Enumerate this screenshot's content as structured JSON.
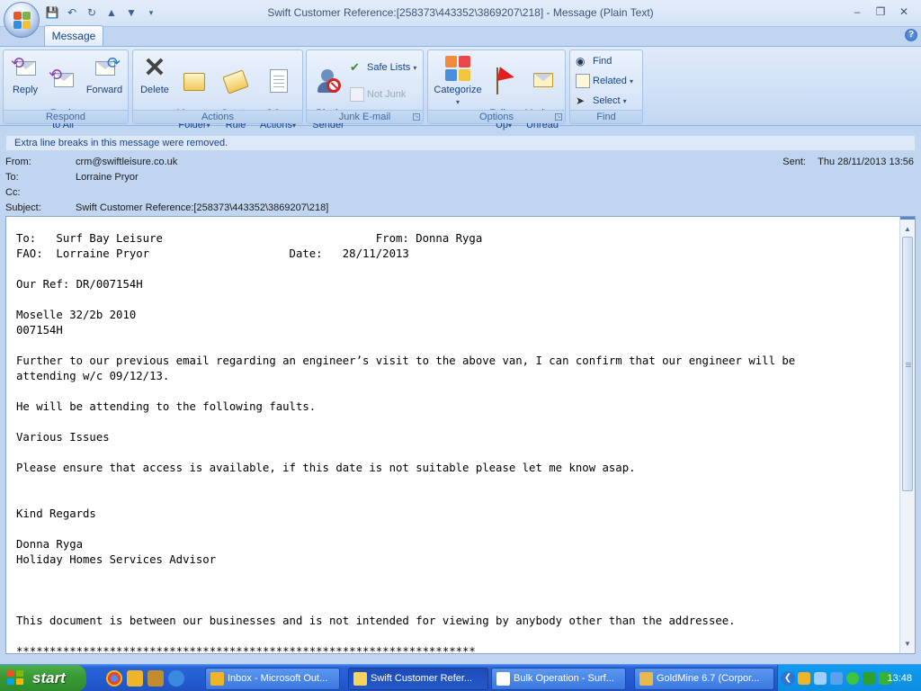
{
  "window": {
    "title": "Swift Customer Reference:[258373\\443352\\3869207\\218] - Message (Plain Text)",
    "minimize": "–",
    "restore": "❐",
    "close": "✕"
  },
  "qat": {
    "save_icon": "save-icon",
    "undo_icon": "undo-icon",
    "redo_icon": "redo-icon",
    "prev_icon": "up-arrow-icon",
    "next_icon": "down-arrow-icon",
    "customize_icon": "chevron-down-icon"
  },
  "tabs": [
    {
      "label": "Message"
    }
  ],
  "help": "?",
  "ribbon": {
    "respond": {
      "label": "Respond",
      "reply": "Reply",
      "reply_all": "Reply\nto All",
      "forward": "Forward"
    },
    "actions": {
      "label": "Actions",
      "delete": "Delete",
      "move_to_folder": "Move to\nFolder",
      "create_rule": "Create\nRule",
      "other_actions": "Other\nActions"
    },
    "junk": {
      "label": "Junk E-mail",
      "block_sender": "Block\nSender",
      "safe_lists": "Safe Lists",
      "not_junk": "Not Junk"
    },
    "options": {
      "label": "Options",
      "categorize": "Categorize",
      "follow_up": "Follow\nUp",
      "mark_as_unread": "Mark as\nUnread"
    },
    "find": {
      "label": "Find",
      "find": "Find",
      "related": "Related",
      "select": "Select"
    }
  },
  "infobar": "Extra line breaks in this message were removed.",
  "header": {
    "from_label": "From:",
    "from": "crm@swiftleisure.co.uk",
    "to_label": "To:",
    "to": "Lorraine Pryor",
    "cc_label": "Cc:",
    "cc": "",
    "subject_label": "Subject:",
    "subject": "Swift Customer Reference:[258373\\443352\\3869207\\218]",
    "sent_label": "Sent:",
    "sent": "Thu 28/11/2013 13:56"
  },
  "body_lines": [
    "To:   Surf Bay Leisure                                From: Donna Ryga",
    "FAO:  Lorraine Pryor                     Date:   28/11/2013",
    "",
    "Our Ref: DR/007154H",
    "",
    "Moselle 32/2b 2010",
    "007154H",
    "",
    "Further to our previous email regarding an engineer’s visit to the above van, I can confirm that our engineer will be",
    "attending w/c 09/12/13.",
    "",
    "He will be attending to the following faults.",
    "",
    "Various Issues",
    "",
    "Please ensure that access is available, if this date is not suitable please let me know asap.",
    "",
    "",
    "Kind Regards",
    "",
    "Donna Ryga",
    "Holiday Homes Services Advisor",
    "",
    "",
    "",
    "This document is between our businesses and is not intended for viewing by anybody other than the addressee.",
    "",
    "*********************************************************************"
  ],
  "taskbar": {
    "start": "start",
    "items": [
      {
        "label": "Inbox - Microsoft Out...",
        "color": "#f0b429"
      },
      {
        "label": "Swift Customer Refer...",
        "color": "#f6d35a"
      },
      {
        "label": "Bulk Operation - Surf...",
        "color": "#ffffff"
      },
      {
        "label": "GoldMine 6.7 (Corpor...",
        "color": "#e8b84a"
      }
    ],
    "clock": "13:48"
  }
}
